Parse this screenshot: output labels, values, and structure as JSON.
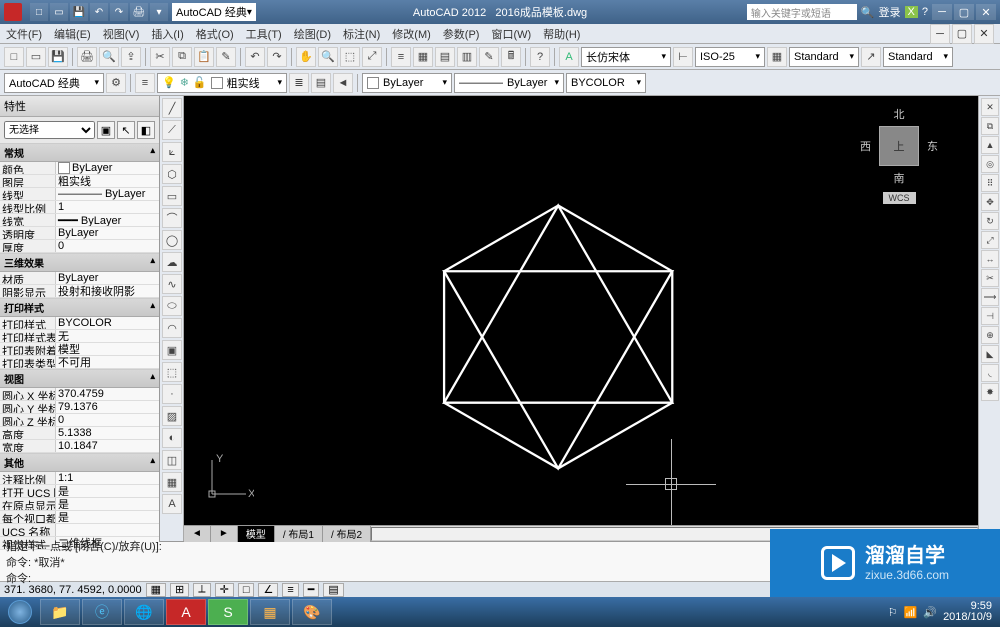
{
  "title": {
    "app": "AutoCAD 2012",
    "file": "2016成品模板.dwg"
  },
  "workspace": "AutoCAD 经典",
  "search_placeholder": "输入关键字或短语",
  "login": "登录",
  "menus": [
    "文件(F)",
    "编辑(E)",
    "视图(V)",
    "插入(I)",
    "格式(O)",
    "工具(T)",
    "绘图(D)",
    "标注(N)",
    "修改(M)",
    "参数(P)",
    "窗口(W)",
    "帮助(H)"
  ],
  "toolbar2": {
    "workspace": "AutoCAD 经典",
    "layer": "粗实线",
    "font": "长仿宋体",
    "iso": "ISO-25",
    "std1": "Standard",
    "std2": "Standard",
    "bylayer1": "ByLayer",
    "bylayer2": "ByLayer",
    "bycolor": "BYCOLOR"
  },
  "properties": {
    "title": "特性",
    "selection": "无选择",
    "sections": {
      "general": {
        "title": "常规",
        "rows": [
          {
            "label": "颜色",
            "value": "ByLayer",
            "swatch": "#ffffff"
          },
          {
            "label": "图层",
            "value": "粗实线"
          },
          {
            "label": "线型",
            "value": "———— ByLayer"
          },
          {
            "label": "线型比例",
            "value": "1"
          },
          {
            "label": "线宽",
            "value": "━━━ ByLayer"
          },
          {
            "label": "透明度",
            "value": "ByLayer"
          },
          {
            "label": "厚度",
            "value": "0"
          }
        ]
      },
      "three_d": {
        "title": "三维效果",
        "rows": [
          {
            "label": "材质",
            "value": "ByLayer"
          },
          {
            "label": "阴影显示",
            "value": "投射和接收阴影"
          }
        ]
      },
      "plot": {
        "title": "打印样式",
        "rows": [
          {
            "label": "打印样式",
            "value": "BYCOLOR"
          },
          {
            "label": "打印样式表",
            "value": "无"
          },
          {
            "label": "打印表附着到",
            "value": "模型"
          },
          {
            "label": "打印表类型",
            "value": "不可用"
          }
        ]
      },
      "view": {
        "title": "视图",
        "rows": [
          {
            "label": "圆心 X 坐标",
            "value": "370.4759"
          },
          {
            "label": "圆心 Y 坐标",
            "value": "79.1376"
          },
          {
            "label": "圆心 Z 坐标",
            "value": "0"
          },
          {
            "label": "高度",
            "value": "5.1338"
          },
          {
            "label": "宽度",
            "value": "10.1847"
          }
        ]
      },
      "misc": {
        "title": "其他",
        "rows": [
          {
            "label": "注释比例",
            "value": "1:1"
          },
          {
            "label": "打开 UCS 图标",
            "value": "是"
          },
          {
            "label": "在原点显示 U...",
            "value": "是"
          },
          {
            "label": "每个视口都显...",
            "value": "是"
          },
          {
            "label": "UCS 名称",
            "value": ""
          },
          {
            "label": "视觉样式",
            "value": "二维线框"
          }
        ]
      }
    }
  },
  "viewcube": {
    "n": "北",
    "s": "南",
    "e": "东",
    "w": "西",
    "top": "上",
    "wcs": "WCS"
  },
  "ucs": {
    "x": "X",
    "y": "Y"
  },
  "tabs": {
    "nav": [
      "◄",
      "►"
    ],
    "items": [
      "模型",
      "/ 布局1",
      "/ 布局2",
      "/"
    ]
  },
  "cmd": {
    "line1": "指定下一点或 [闭合(C)/放弃(U)]:",
    "line2": "命令: *取消*",
    "prompt": "命令:"
  },
  "status": {
    "coords": "371. 3680,  77. 4592,  0.0000"
  },
  "watermark": {
    "big": "溜溜自学",
    "small": "zixue.3d66.com"
  },
  "clock": {
    "time": "9:59",
    "date": "2018/10/9"
  }
}
